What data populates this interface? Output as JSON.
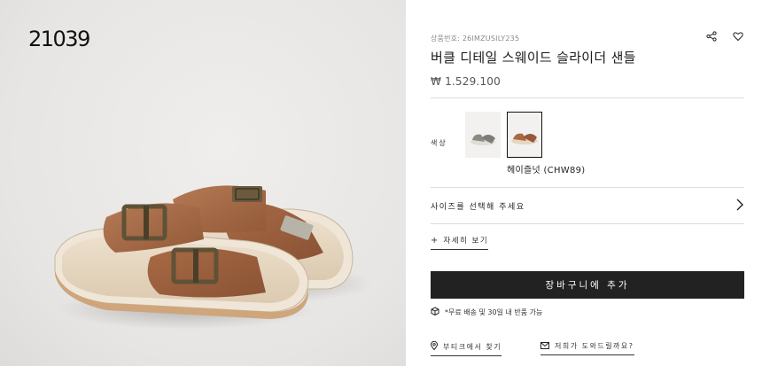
{
  "brand": {
    "logo_text": "21039"
  },
  "product": {
    "sku": "상품번호: 26IMZUSILY235",
    "title": "버클 디테일 스웨이드 슬라이더 샌들",
    "price": "₩ 1.529.100"
  },
  "actions": {
    "share_icon": "share-icon",
    "wishlist_icon": "heart-icon"
  },
  "color": {
    "label": "색상",
    "options": [
      {
        "name": "grey-suede",
        "color": "#8b8a85",
        "selected": false
      },
      {
        "name": "헤이즐넛 (CHW89)",
        "color": "#a86a45",
        "selected": true
      }
    ],
    "selected_caption": "헤이즐넛 (CHW89)"
  },
  "size": {
    "prompt": "사이즈를 선택해 주세요",
    "icon": "chevron-right-icon"
  },
  "details_link": {
    "plus": "+",
    "label": "자세히 보기"
  },
  "cart": {
    "button_label": "장바구니에 추가"
  },
  "shipping": {
    "icon": "box-icon",
    "text": "*무료 배송 및 30일 내 반품 가능"
  },
  "footer_links": [
    {
      "icon": "location-pin-icon",
      "label": "부티크에서 찾기"
    },
    {
      "icon": "mail-icon",
      "label": "저희가 도와드릴까요?"
    }
  ],
  "colors": {
    "button_bg": "#222222",
    "suede": "#a86a45",
    "footbed": "#e7d9c5",
    "sole": "#efe6d8"
  }
}
